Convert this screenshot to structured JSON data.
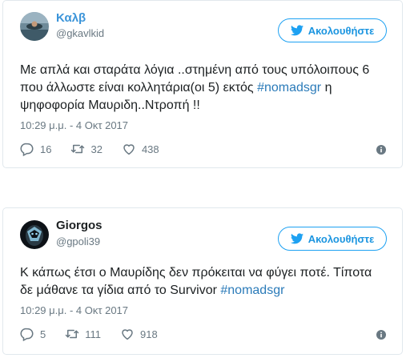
{
  "tweets": [
    {
      "display_name": "Καλβ",
      "handle": "@gkavlkid",
      "follow_label": "Ακολουθήστε",
      "text_main": "Με απλά και σταράτα λόγια ..στημένη από τους υπόλοιπους 6 που άλλωστε είναι κολλητάρια(οι 5) εκτός ",
      "hashtag": "#nomadsgr",
      "text_after": " η ψηφοφορία Μαυριδη..Ντροπή !!",
      "timestamp": "10:29 μ.μ. - 4 Οκτ 2017",
      "replies": "16",
      "retweets": "32",
      "likes": "438",
      "icons": [
        "speech-bubble-icon",
        "retweet-icon",
        "heart-icon",
        "info-icon",
        "twitter-bird-icon"
      ]
    },
    {
      "display_name": "Giorgos",
      "handle": "@gpoli39",
      "follow_label": "Ακολουθήστε",
      "text_main": "Κ κάπως έτσι ο Μαυρίδης δεν πρόκειται να φύγει ποτέ. Τίποτα δε μάθανε τα γίδια από το Survivor ",
      "hashtag": "#nomadsgr",
      "text_after": "",
      "timestamp": "10:29 μ.μ. - 4 Οκτ 2017",
      "replies": "5",
      "retweets": "111",
      "likes": "918",
      "icons": [
        "speech-bubble-icon",
        "retweet-icon",
        "heart-icon",
        "info-icon",
        "twitter-bird-icon"
      ]
    }
  ],
  "colors": {
    "twitter_blue": "#1da1f2",
    "link_blue": "#2b7bb9",
    "name_blue": "#3b94d9",
    "text": "#1c2022",
    "muted": "#697882",
    "border": "#e1e8ed"
  }
}
